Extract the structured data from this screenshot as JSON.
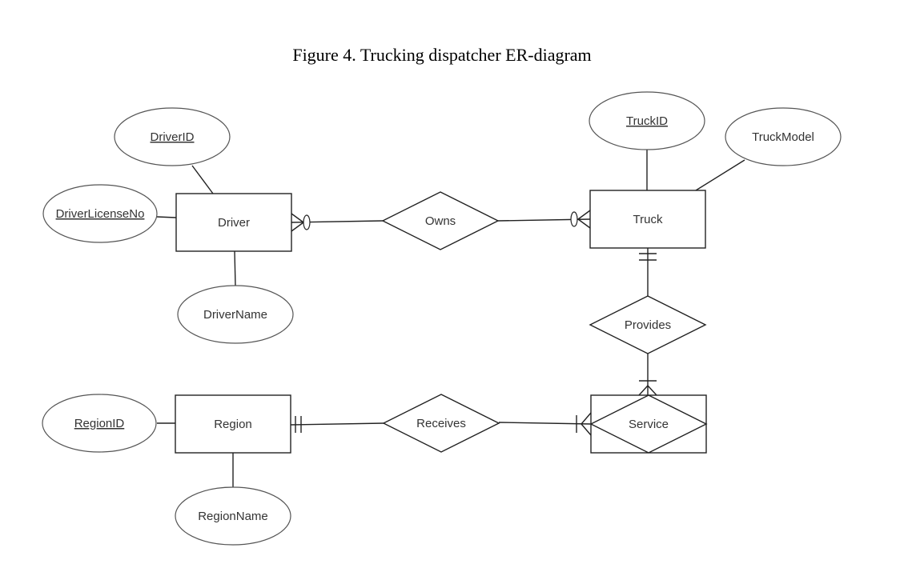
{
  "figure": {
    "caption": "Figure 4. Trucking dispatcher ER-diagram"
  },
  "entities": {
    "driver": "Driver",
    "truck": "Truck",
    "region": "Region",
    "service": "Service"
  },
  "relationships": {
    "owns": "Owns",
    "provides": "Provides",
    "receives": "Receives"
  },
  "attributes": {
    "driver_id": {
      "label": "DriverID",
      "key": true
    },
    "driver_license_no": {
      "label": "DriverLicenseNo",
      "key": true
    },
    "driver_name": {
      "label": "DriverName",
      "key": false
    },
    "truck_id": {
      "label": "TruckID",
      "key": true
    },
    "truck_model": {
      "label": "TruckModel",
      "key": false
    },
    "region_id": {
      "label": "RegionID",
      "key": true
    },
    "region_name": {
      "label": "RegionName",
      "key": false
    }
  },
  "cardinalities": {
    "driver_owns": "zero-or-many",
    "truck_owns": "zero-or-many",
    "truck_provides": "one-and-only-one",
    "service_provides": "one-or-many",
    "region_receives": "one-and-only-one",
    "service_receives": "one-or-many"
  }
}
